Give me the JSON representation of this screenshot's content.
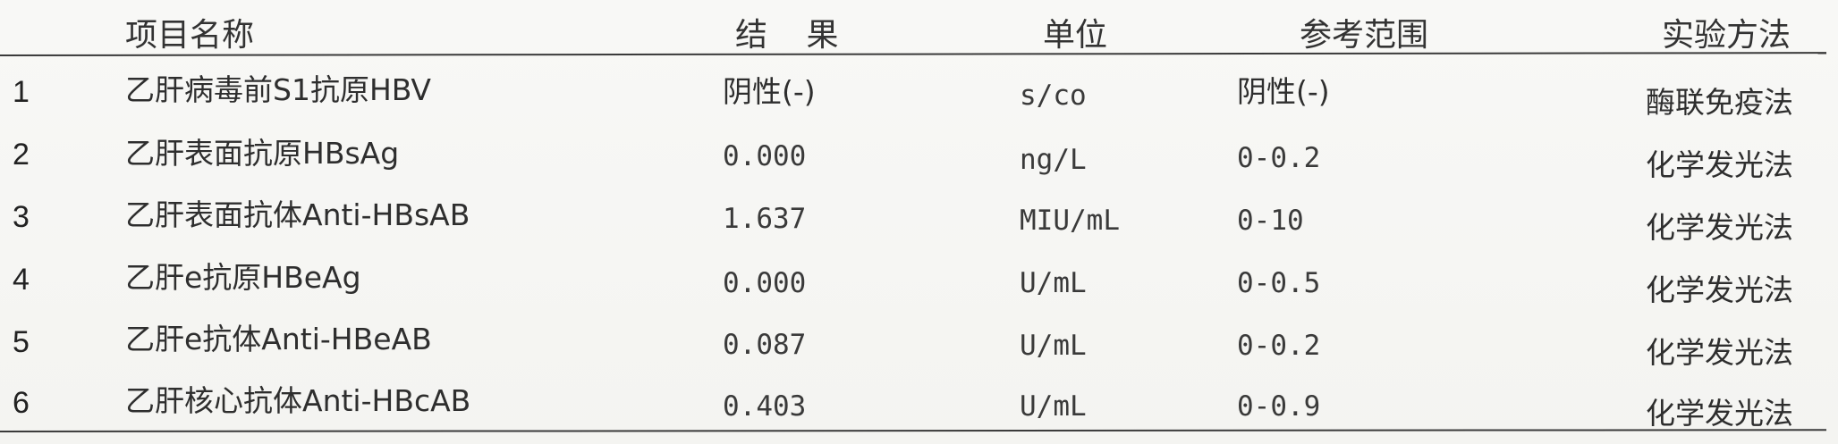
{
  "headers": {
    "name": "项目名称",
    "result": "结 果",
    "unit": "单位",
    "reference": "参考范围",
    "method": "实验方法"
  },
  "rows": [
    {
      "no": "1",
      "name": "乙肝病毒前S1抗原HBV",
      "result": "阴性(-)",
      "unit": "s/co",
      "reference": "阴性(-)",
      "method": "酶联免疫法"
    },
    {
      "no": "2",
      "name": "乙肝表面抗原HBsAg",
      "result": "0.000",
      "unit": "ng/L",
      "reference": "0-0.2",
      "method": "化学发光法"
    },
    {
      "no": "3",
      "name": "乙肝表面抗体Anti-HBsAB",
      "result": "1.637",
      "unit": "MIU/mL",
      "reference": "0-10",
      "method": "化学发光法"
    },
    {
      "no": "4",
      "name": "乙肝e抗原HBeAg",
      "result": "0.000",
      "unit": "U/mL",
      "reference": "0-0.5",
      "method": "化学发光法"
    },
    {
      "no": "5",
      "name": "乙肝e抗体Anti-HBeAB",
      "result": "0.087",
      "unit": "U/mL",
      "reference": "0-0.2",
      "method": "化学发光法"
    },
    {
      "no": "6",
      "name": "乙肝核心抗体Anti-HBcAB",
      "result": "0.403",
      "unit": "U/mL",
      "reference": "0-0.9",
      "method": "化学发光法"
    }
  ]
}
